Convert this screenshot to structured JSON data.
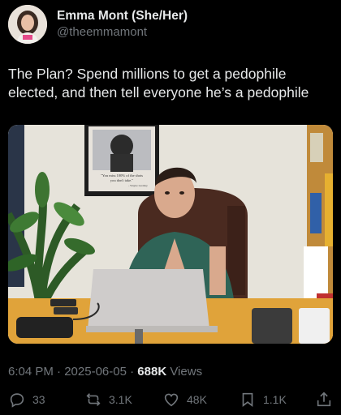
{
  "author": {
    "display_name": "Emma Mont (She/Her)",
    "handle": "@theemmamont"
  },
  "tweet": {
    "text": "The Plan? Spend millions to get a pedophile elected, and then tell everyone he’s a pedophile"
  },
  "media": {
    "poster_lines": [
      "\"You miss 100% of the shots",
      "you don't take.\"",
      "- Wayne Gretzky"
    ]
  },
  "meta": {
    "time": "6:04 PM",
    "separator": " · ",
    "date": "2025-06-05",
    "views_count": "688K",
    "views_label": " Views"
  },
  "actions": {
    "replies": "33",
    "reposts": "3.1K",
    "likes": "48K",
    "bookmarks": "1.1K"
  },
  "colors": {
    "background": "#000000",
    "primary_text": "#e7e9ea",
    "secondary_text": "#71767b"
  },
  "icons": {
    "reply": "reply-icon",
    "repost": "repost-icon",
    "like": "like-icon",
    "bookmark": "bookmark-icon",
    "share": "share-icon"
  }
}
